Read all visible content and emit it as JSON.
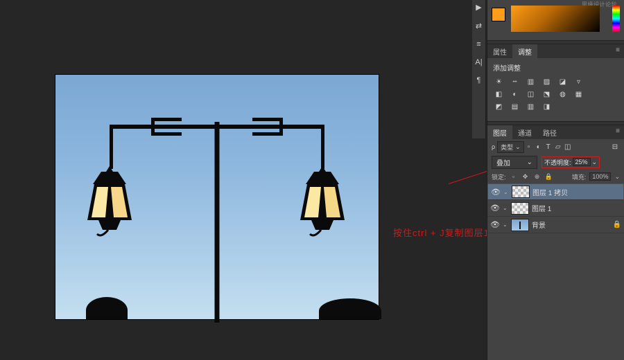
{
  "toolbar": {
    "icons": [
      "▶",
      "⇄",
      "≡",
      "A|",
      "¶"
    ]
  },
  "color": {
    "watermark": "思缘设计论坛"
  },
  "props_tabs": {
    "t1": "属性",
    "t2": "调整"
  },
  "adjustments": {
    "title": "添加调整",
    "rows": [
      [
        "☀",
        "┉",
        "▥",
        "▨",
        "◪",
        "▿"
      ],
      [
        "◧",
        "◐",
        "◫",
        "⬔",
        "◍",
        "▦"
      ],
      [
        "◩",
        "▤",
        "▥",
        "◨"
      ]
    ]
  },
  "layers_tabs": {
    "t1": "图层",
    "t2": "通道",
    "t3": "路径"
  },
  "layer_opts": {
    "kind": "类型"
  },
  "blend": {
    "mode": "叠加",
    "op_label": "不透明度:",
    "op_value": "25%"
  },
  "lock": {
    "label": "锁定:",
    "fill_label": "填充:",
    "fill_value": "100%"
  },
  "layers": [
    {
      "name": "图层 1 拷贝",
      "selected": true,
      "thumb": "checker"
    },
    {
      "name": "图层 1",
      "thumb": "checker"
    },
    {
      "name": "背景",
      "thumb": "bg",
      "locked": true
    }
  ],
  "annotation": {
    "text": "按住ctrl + J复制图层1"
  }
}
